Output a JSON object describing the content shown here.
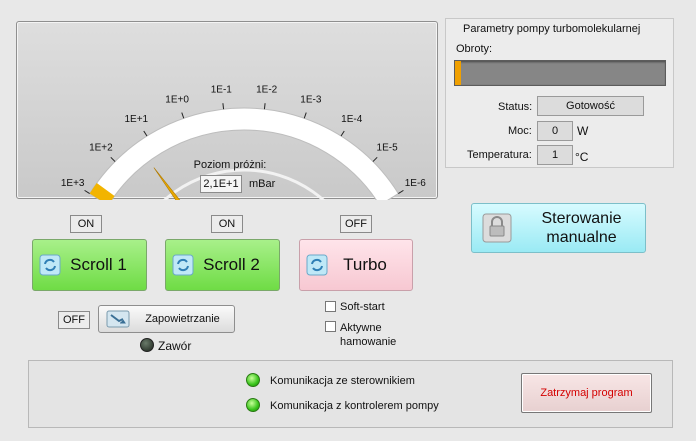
{
  "gauge": {
    "scale_labels": [
      "1E+3",
      "1E+2",
      "1E+1",
      "1E+0",
      "1E-1",
      "1E-2",
      "1E-3",
      "1E-4",
      "1E-5",
      "1E-6"
    ],
    "caption": "Poziom próżni:",
    "value": "2,1E+1",
    "unit": "mBar",
    "needle_value": 21,
    "colors": {
      "arc": "#ffffff",
      "warning": "#f2b400",
      "needle": "#e8a800"
    }
  },
  "params": {
    "title": "Parametry pompy turbomolekularnej",
    "rpm_label": "Obroty:",
    "rpm_fraction": 0.01,
    "status_label": "Status:",
    "status_value": "Gotowość",
    "power_label": "Moc:",
    "power_value": "0",
    "power_unit": "W",
    "temp_label": "Temperatura:",
    "temp_value": "1",
    "temp_unit": "°C"
  },
  "pumps": {
    "scroll1": {
      "state": "ON",
      "label": "Scroll 1",
      "icon": "refresh-icon"
    },
    "scroll2": {
      "state": "ON",
      "label": "Scroll 2",
      "icon": "refresh-icon"
    },
    "turbo": {
      "state": "OFF",
      "label": "Turbo",
      "icon": "refresh-icon"
    }
  },
  "turbo_options": {
    "soft_start": "Soft-start",
    "active_braking_line1": "Aktywne",
    "active_braking_line2": "hamowanie"
  },
  "venting": {
    "state": "OFF",
    "button_label": "Zapowietrzanie",
    "valve_label": "Zawór",
    "icon": "vent-icon"
  },
  "manual": {
    "label_line1": "Sterowanie",
    "label_line2": "manualne",
    "icon": "lock-icon"
  },
  "status_panel": {
    "controller_comm": "Komunikacja ze sterownikiem",
    "pump_comm": "Komunikacja z kontrolerem pompy",
    "stop_label": "Zatrzymaj program"
  }
}
